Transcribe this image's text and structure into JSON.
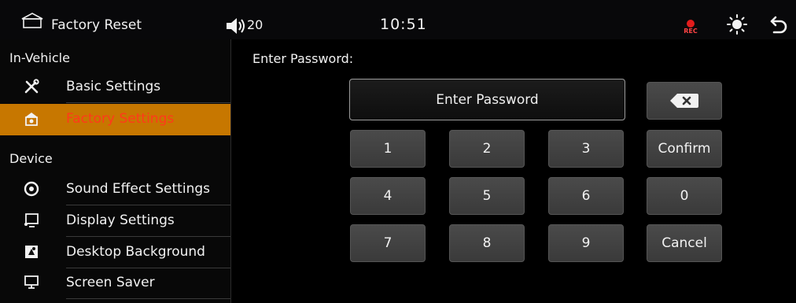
{
  "topbar": {
    "title": "Factory Reset",
    "icons": [
      "home-outline-icon",
      "volume-icon",
      "rec-icon",
      "brightness-icon",
      "back-icon"
    ],
    "volume": "20",
    "time": "10:51",
    "rec_label": "REC"
  },
  "sidebar": {
    "section_in_vehicle": "In-Vehicle",
    "section_device": "Device",
    "items": [
      {
        "label": "Basic Settings",
        "icon": "tools-icon"
      },
      {
        "label": "Factory Settings",
        "icon": "factory-icon",
        "active": true
      },
      {
        "label": "Sound Effect Settings",
        "icon": "speaker-icon"
      },
      {
        "label": "Display Settings",
        "icon": "display-icon"
      },
      {
        "label": "Desktop Background",
        "icon": "wallpaper-icon"
      },
      {
        "label": "Screen Saver",
        "icon": "monitor-icon"
      }
    ]
  },
  "main": {
    "prompt": "Enter Password:",
    "input_placeholder": "Enter Password",
    "input_value": "",
    "keys": [
      "1",
      "2",
      "3",
      "Confirm",
      "4",
      "5",
      "6",
      "0",
      "7",
      "8",
      "9",
      "Cancel"
    ],
    "backspace_icon": "backspace-icon"
  },
  "colors": {
    "accent": "#c77700",
    "active_text": "#ff3a1a",
    "key_bg": "#424242",
    "background": "#000000"
  }
}
